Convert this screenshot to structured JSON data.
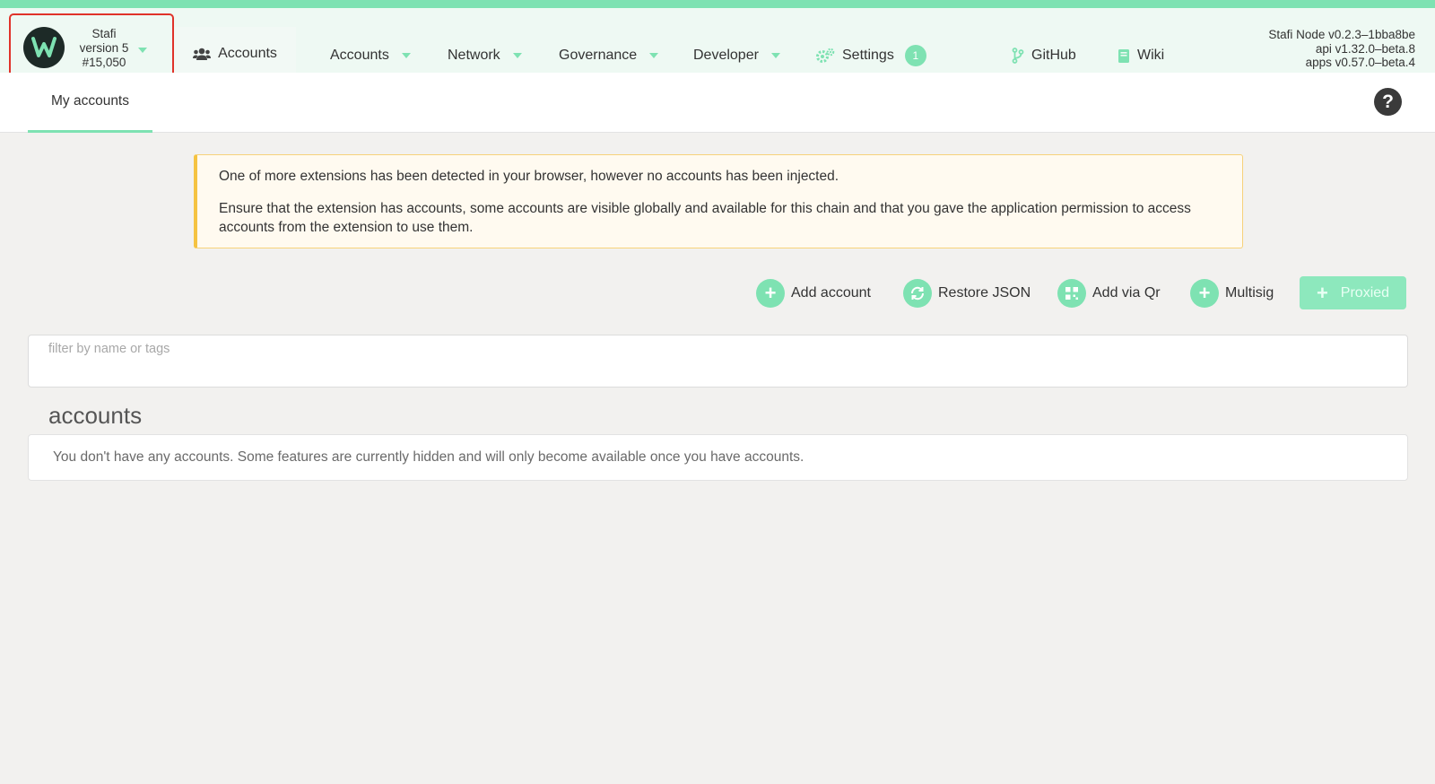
{
  "chain": {
    "name": "Stafi",
    "version": "version 5",
    "block": "#15,050"
  },
  "header": {
    "active_tab_label": "Accounts",
    "menu": [
      {
        "label": "Accounts",
        "icon": "chevron-down-icon"
      },
      {
        "label": "Network",
        "icon": "chevron-down-icon"
      },
      {
        "label": "Governance",
        "icon": "chevron-down-icon"
      },
      {
        "label": "Developer",
        "icon": "chevron-down-icon"
      },
      {
        "label": "Settings",
        "icon": "gears-icon",
        "badge": "1"
      },
      {
        "label": "GitHub",
        "icon": "branch-icon"
      },
      {
        "label": "Wiki",
        "icon": "book-icon"
      }
    ],
    "version_info": {
      "node": "Stafi Node v0.2.3–1bba8be",
      "api": "api v1.32.0–beta.8",
      "apps": "apps v0.57.0–beta.4"
    }
  },
  "subnav": {
    "tab_label": "My accounts"
  },
  "warning": {
    "line1": "One of more extensions has been detected in your browser, however no accounts has been injected.",
    "line2": "Ensure that the extension has accounts, some accounts are visible globally and available for this chain and that you gave the application permission to access accounts from the extension to use them."
  },
  "actions": {
    "add_account": "Add account",
    "restore_json": "Restore JSON",
    "add_via_qr": "Add via Qr",
    "multisig": "Multisig",
    "proxied": "Proxied"
  },
  "filter": {
    "placeholder": "filter by name or tags",
    "value": ""
  },
  "accounts": {
    "title": "accounts",
    "empty_message": "You don't have any accounts. Some features are currently hidden and will only become available once you have accounts."
  },
  "colors": {
    "accent": "#7ee2b2",
    "header_bg": "#eef9f3",
    "highlight_border": "#e0332a",
    "warning_border": "#f5c342"
  }
}
